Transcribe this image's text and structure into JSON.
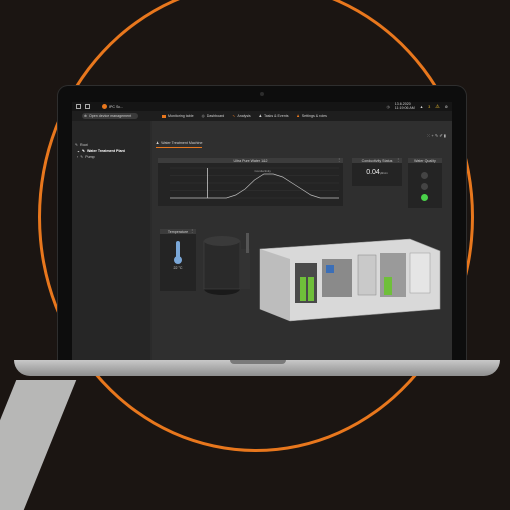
{
  "topbar": {
    "brand": "IPC Sc...",
    "date": "13.6.2020",
    "time": "11:19:06 AM",
    "alert_count": "3"
  },
  "subbar": {
    "device_button": "Open device management",
    "tabs": [
      {
        "label": "Monitoring table"
      },
      {
        "label": "Dashboard"
      },
      {
        "label": "Analysis"
      },
      {
        "label": "Tasks & Events"
      },
      {
        "label": "Settings & roles"
      }
    ]
  },
  "sidebar": {
    "root": "Root",
    "items": [
      {
        "label": "Water Treatment Plant"
      },
      {
        "label": "Pump"
      }
    ]
  },
  "main": {
    "title": "Water Treatment Machine"
  },
  "widgets": {
    "chart_title": "Ultra Pure Water 1&2",
    "chart_annotation": "Conductivity",
    "conductivity_title": "Conductivity Status",
    "conductivity_value": "0.04",
    "conductivity_unit": "µS/cm",
    "quality_title": "Water Quality",
    "temperature_title": "Temperature",
    "temperature_value": "22 °C"
  },
  "quality_lights": [
    false,
    false,
    true
  ],
  "colors": {
    "accent": "#e8771d",
    "good": "#4ad14a",
    "thermo": "#7aa7d8"
  },
  "chart_data": {
    "type": "line",
    "title": "Ultra Pure Water 1&2",
    "series": [
      {
        "name": "Conductivity",
        "values": [
          0.0,
          0.0,
          0.0,
          0.0,
          0.0,
          0.0,
          0.0,
          0.1,
          0.3,
          0.6,
          0.8,
          0.8,
          0.7,
          0.5,
          0.3,
          0.1,
          0.0,
          0.0,
          0.0
        ]
      }
    ],
    "spike_at_index": 4,
    "ylim": [
      0,
      1
    ],
    "grid": true
  }
}
